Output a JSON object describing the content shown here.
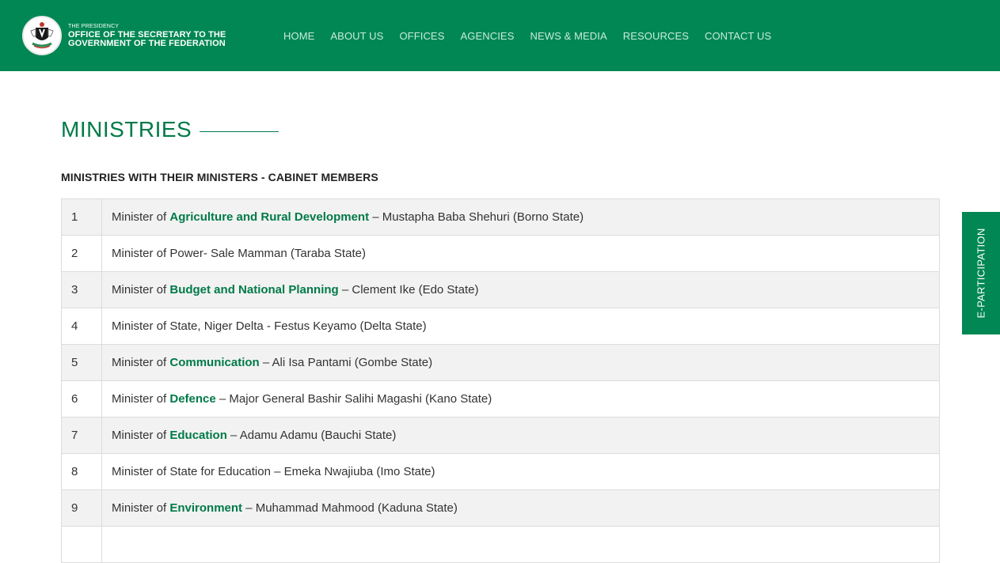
{
  "header": {
    "logo_small": "THE PRESIDENCY",
    "logo_line1": "OFFICE OF THE SECRETARY TO THE",
    "logo_line2": "GOVERNMENT OF THE FEDERATION",
    "bg_color": "#008753",
    "crest_icon": "coat-of-arms-icon"
  },
  "nav": [
    {
      "label": "HOME"
    },
    {
      "label": "ABOUT US"
    },
    {
      "label": "OFFICES"
    },
    {
      "label": "AGENCIES"
    },
    {
      "label": "NEWS & MEDIA"
    },
    {
      "label": "RESOURCES"
    },
    {
      "label": "CONTACT US"
    }
  ],
  "page": {
    "title": "MINISTRIES",
    "subtitle": "MINISTRIES WITH THEIR MINISTERS - CABINET MEMBERS"
  },
  "side_tab": {
    "label": "E-PARTICIPATION"
  },
  "colors": {
    "accent": "#007a48",
    "row_alt": "#f2f2f2"
  },
  "ministries": [
    {
      "num": "1",
      "prefix": "Minister of ",
      "ministry": "Agriculture and Rural Development",
      "rest": " – Mustapha Baba Shehuri (Borno State)"
    },
    {
      "num": "2",
      "prefix": "Minister of Power- Sale Mamman (Taraba State)",
      "ministry": "",
      "rest": ""
    },
    {
      "num": "3",
      "prefix": "Minister of ",
      "ministry": "Budget and National Planning",
      "rest": " – Clement Ike (Edo State)"
    },
    {
      "num": "4",
      "prefix": "Minister of State, Niger Delta - Festus Keyamo  (Delta State)",
      "ministry": "",
      "rest": ""
    },
    {
      "num": "5",
      "prefix": "Minister of ",
      "ministry": "Communication",
      "rest": " – Ali Isa Pantami (Gombe State)"
    },
    {
      "num": "6",
      "prefix": "Minister of ",
      "ministry": "Defence",
      "rest": " – Major General Bashir Salihi Magashi (Kano State)"
    },
    {
      "num": "7",
      "prefix": "Minister of ",
      "ministry": "Education",
      "rest": " – Adamu Adamu (Bauchi State)"
    },
    {
      "num": "8",
      "prefix": "Minister of State for Education – Emeka Nwajiuba (Imo State)",
      "ministry": "",
      "rest": ""
    },
    {
      "num": "9",
      "prefix": "Minister of ",
      "ministry": "Environment",
      "rest": " – Muhammad Mahmood (Kaduna State)"
    },
    {
      "num": "",
      "prefix": "",
      "ministry": "",
      "rest": ""
    }
  ]
}
